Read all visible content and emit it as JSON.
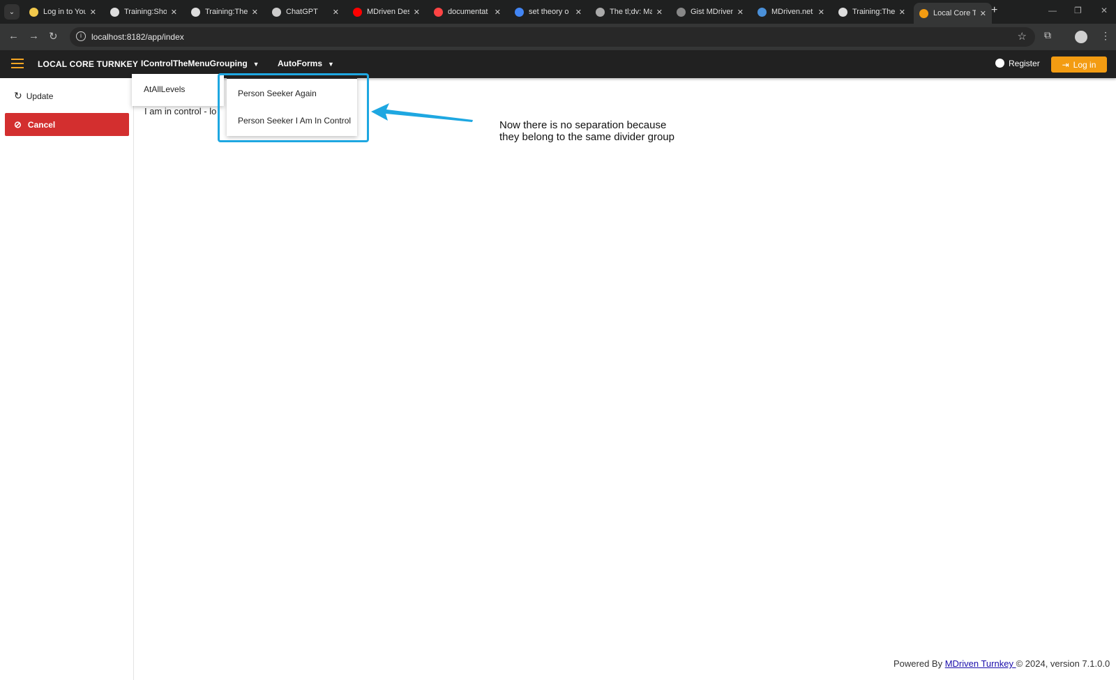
{
  "browser": {
    "tabs": [
      {
        "label": "Log in to You",
        "color": "#f2c94c"
      },
      {
        "label": "Training:Sho",
        "color": "#dddddd"
      },
      {
        "label": "Training:The",
        "color": "#dddddd"
      },
      {
        "label": "ChatGPT",
        "color": "#cccccc"
      },
      {
        "label": "MDriven Des",
        "color": "#ff0000"
      },
      {
        "label": "documentat",
        "color": "#ff4444"
      },
      {
        "label": "set theory o",
        "color": "#4285f4"
      },
      {
        "label": "The tl;dv: Ma",
        "color": "#aaaaaa"
      },
      {
        "label": "Gist MDriven",
        "color": "#888888"
      },
      {
        "label": "MDriven.net",
        "color": "#4a90d9"
      },
      {
        "label": "Training:The",
        "color": "#dddddd"
      },
      {
        "label": "Local Core T",
        "color": "#f39c12"
      }
    ],
    "url": "localhost:8182/app/index"
  },
  "appbar": {
    "brand": "LOCAL CORE TURNKEY",
    "menu1": "IControlTheMenuGrouping",
    "menu2": "AutoForms",
    "register": "Register",
    "login": "Log in",
    "accent": "#f39c12"
  },
  "sidebar": {
    "update": "Update",
    "cancel": "Cancel",
    "cancel_color": "#d32f2f"
  },
  "content": {
    "text": "I am in control - lo"
  },
  "dropdown1": {
    "items": [
      "AtAllLevels"
    ]
  },
  "dropdown2": {
    "items": [
      "Person Seeker Again",
      "Person Seeker I Am In Control"
    ]
  },
  "annotation": {
    "line1": "Now there is no separation because",
    "line2": "they belong to the same divider group",
    "color": "#1ea7e1"
  },
  "footer": {
    "prefix": "Powered By ",
    "link": "MDriven Turnkey ",
    "suffix": "© 2024, version 7.1.0.0"
  }
}
